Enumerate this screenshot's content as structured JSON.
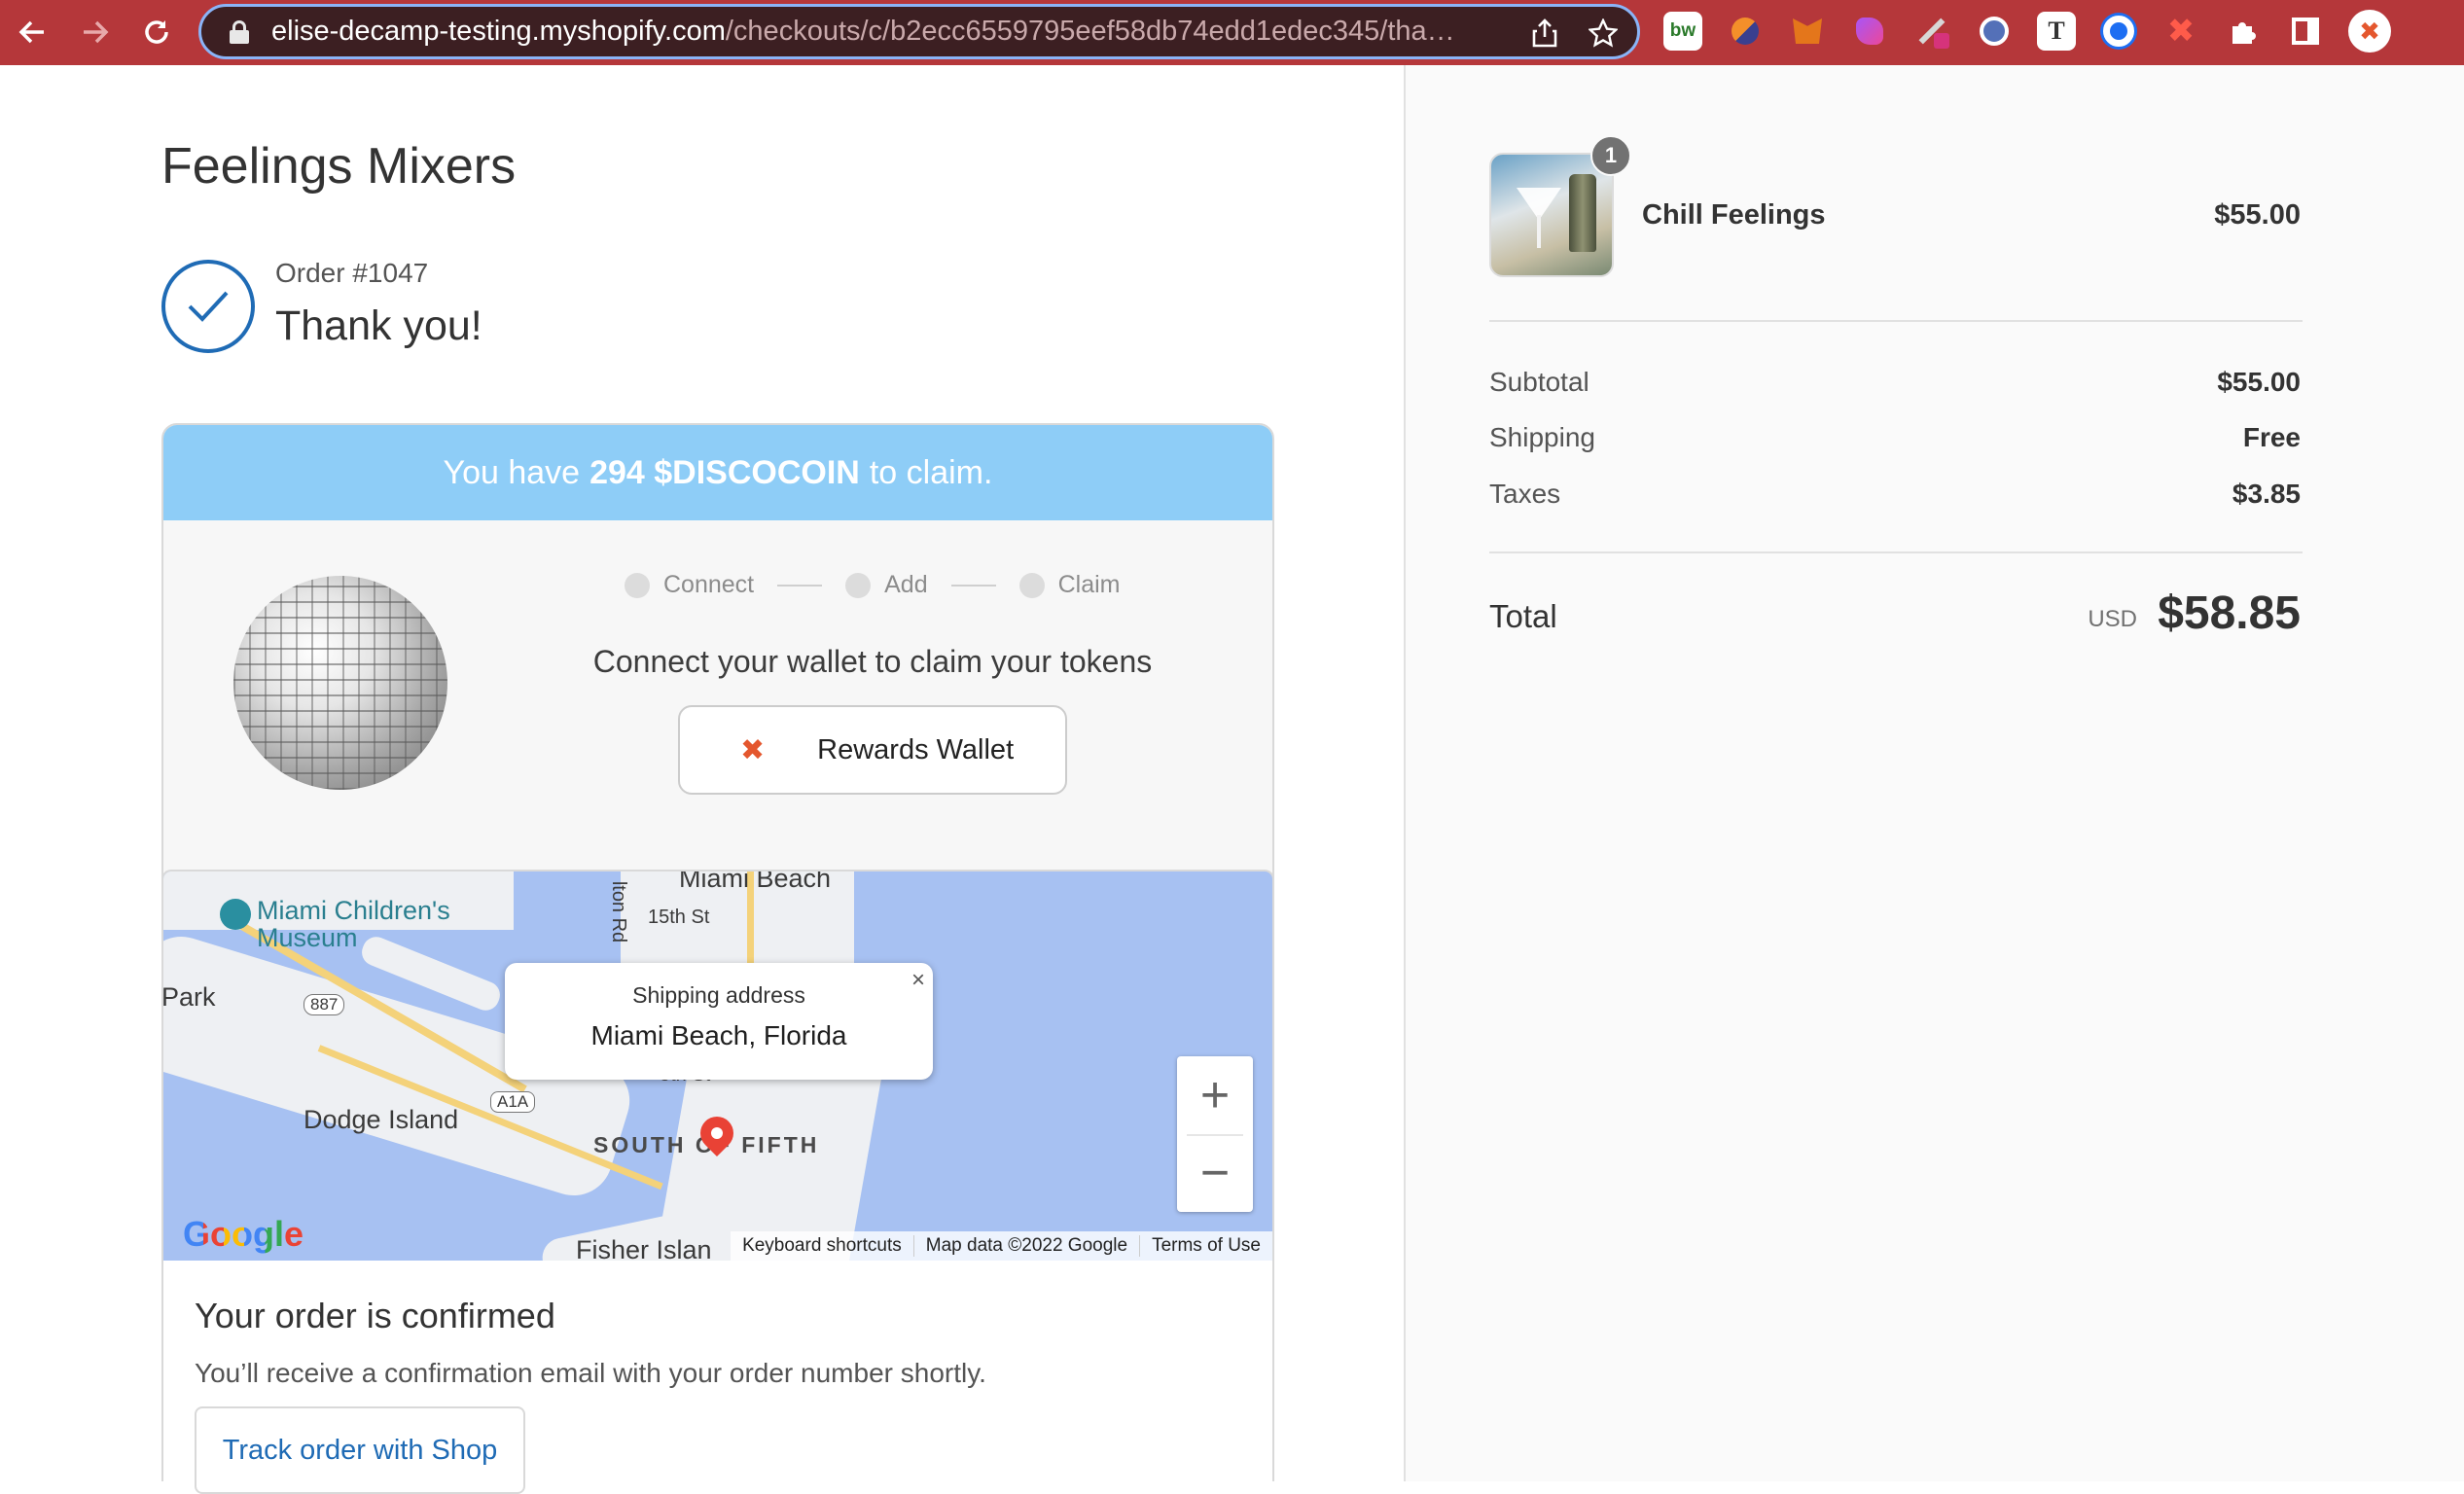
{
  "browser": {
    "url_host": "elise-decamp-testing.myshopify.com",
    "url_path": "/checkouts/c/b2ecc6559795eef58db74edd1edec345/tha…",
    "extensions": [
      "bw-extension-icon",
      "brave-extension-icon",
      "metamask-fox-icon",
      "purple-extension-icon",
      "pen-extension-icon",
      "time-extension-icon",
      "font-extension-icon",
      "target-extension-icon",
      "red-x-extension-icon",
      "puzzle-extensions-icon",
      "sidepanel-icon",
      "profile-icon"
    ],
    "ext_bw_text": "bw",
    "ext_font_text": "T"
  },
  "shop": {
    "name": "Feelings Mixers"
  },
  "order": {
    "number": "Order #1047",
    "thanks": "Thank you!"
  },
  "rewards": {
    "banner_prefix": "You have",
    "banner_amount": "294 $DISCOCOIN",
    "banner_suffix": "to claim.",
    "steps": [
      "Connect",
      "Add",
      "Claim"
    ],
    "message": "Connect your wallet to claim your tokens",
    "wallet_button": "Rewards Wallet"
  },
  "map": {
    "labels": {
      "miami_beach": "Miami Beach",
      "childrens_museum": "Miami Children's\nMuseum",
      "park": "Park",
      "dodge_island": "Dodge Island",
      "south_of_fifth": "SOUTH OF FIFTH",
      "fisher_island": "Fisher Islan",
      "fifteenth_st": "15th St",
      "alton_rd": "lton Rd",
      "fifth_st": "5th St",
      "route_887": "887",
      "route_a1a": "A1A"
    },
    "popup_title": "Shipping address",
    "popup_address": "Miami Beach, Florida",
    "popup_close": "×",
    "zoom_in": "+",
    "zoom_out": "−",
    "google": "Google",
    "footer": [
      "Keyboard shortcuts",
      "Map data ©2022 Google",
      "Terms of Use"
    ]
  },
  "confirmation": {
    "title": "Your order is confirmed",
    "text": "You’ll receive a confirmation email with your order number shortly.",
    "track_button": "Track order with Shop"
  },
  "summary": {
    "item": {
      "name": "Chill Feelings",
      "price": "$55.00",
      "quantity": "1"
    },
    "subtotal_label": "Subtotal",
    "subtotal_value": "$55.00",
    "shipping_label": "Shipping",
    "shipping_value": "Free",
    "taxes_label": "Taxes",
    "taxes_value": "$3.85",
    "total_label": "Total",
    "currency": "USD",
    "total_value": "$58.85"
  },
  "colors": {
    "chrome": "#b5373a",
    "banner": "#8ecdf7",
    "accent": "#1f6bb5",
    "water": "#a7c1f2",
    "pin": "#e94235"
  }
}
